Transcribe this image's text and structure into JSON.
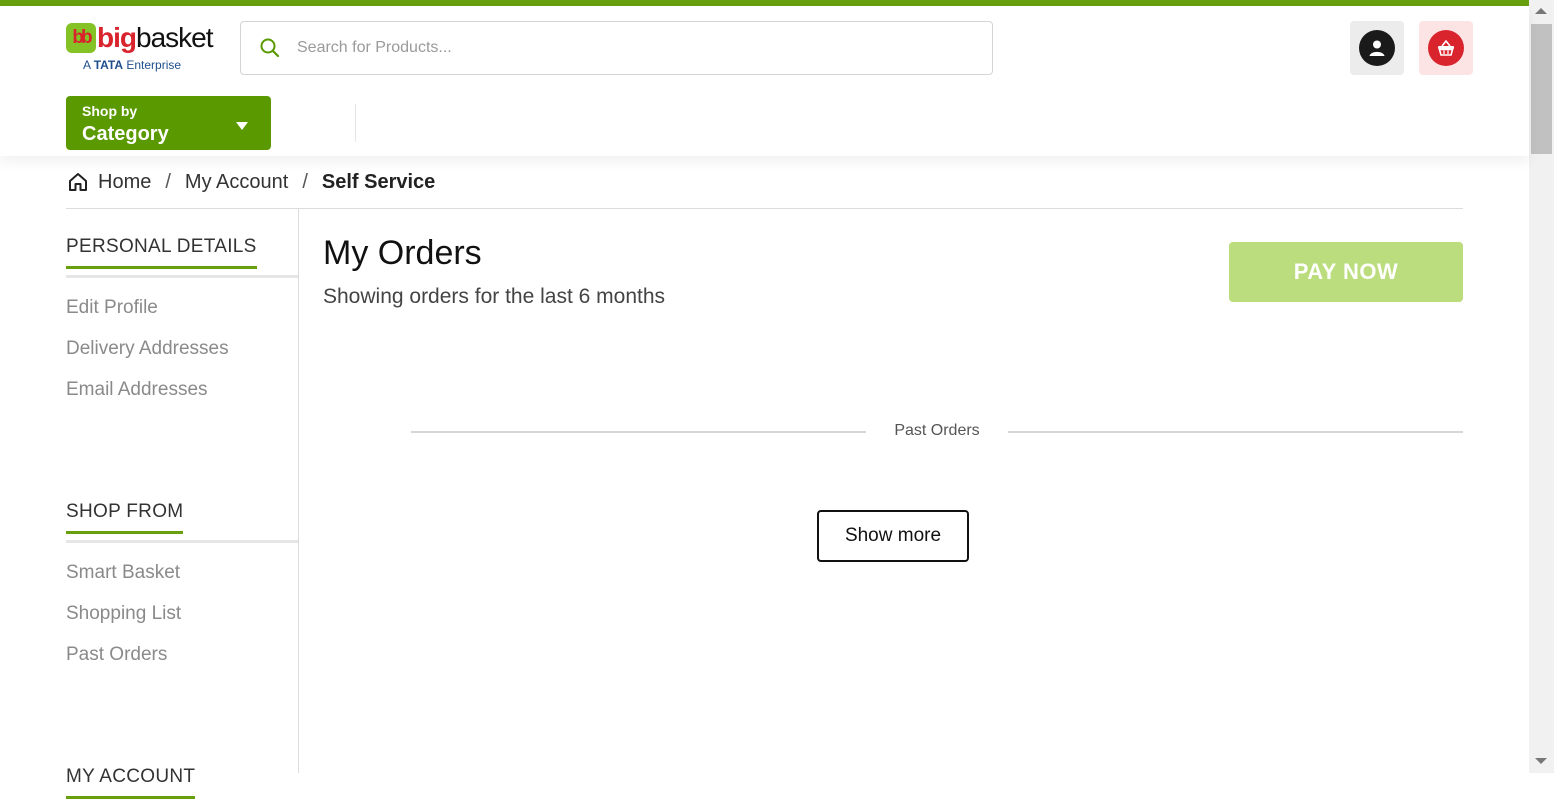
{
  "brand": {
    "logo_mark": "bb",
    "name_part1": "big",
    "name_part2": "basket",
    "tagline_prefix": "A",
    "tagline_brand": "TATA",
    "tagline_suffix": "Enterprise",
    "green": "#689f0e",
    "red": "#d9232d"
  },
  "search": {
    "placeholder": "Search for Products..."
  },
  "header": {
    "shop_by_line1": "Shop by",
    "shop_by_line2": "Category"
  },
  "icons": {
    "search": "search-icon",
    "user": "user-icon",
    "cart": "basket-icon",
    "home": "home-icon",
    "caret": "caret-down-icon"
  },
  "breadcrumb": {
    "items": [
      "Home",
      "My Account"
    ],
    "separator": "/",
    "current": "Self Service"
  },
  "sidebar": {
    "sections": [
      {
        "heading": "PERSONAL DETAILS",
        "items": [
          "Edit Profile",
          "Delivery Addresses",
          "Email Addresses"
        ]
      },
      {
        "heading": "SHOP FROM",
        "items": [
          "Smart Basket",
          "Shopping List",
          "Past Orders"
        ]
      },
      {
        "heading": "MY ACCOUNT",
        "items": []
      }
    ]
  },
  "main": {
    "title": "My Orders",
    "subtitle": "Showing orders for the last 6 months",
    "pay_now_label": "PAY NOW",
    "past_orders_label": "Past Orders",
    "show_more_label": "Show more"
  }
}
